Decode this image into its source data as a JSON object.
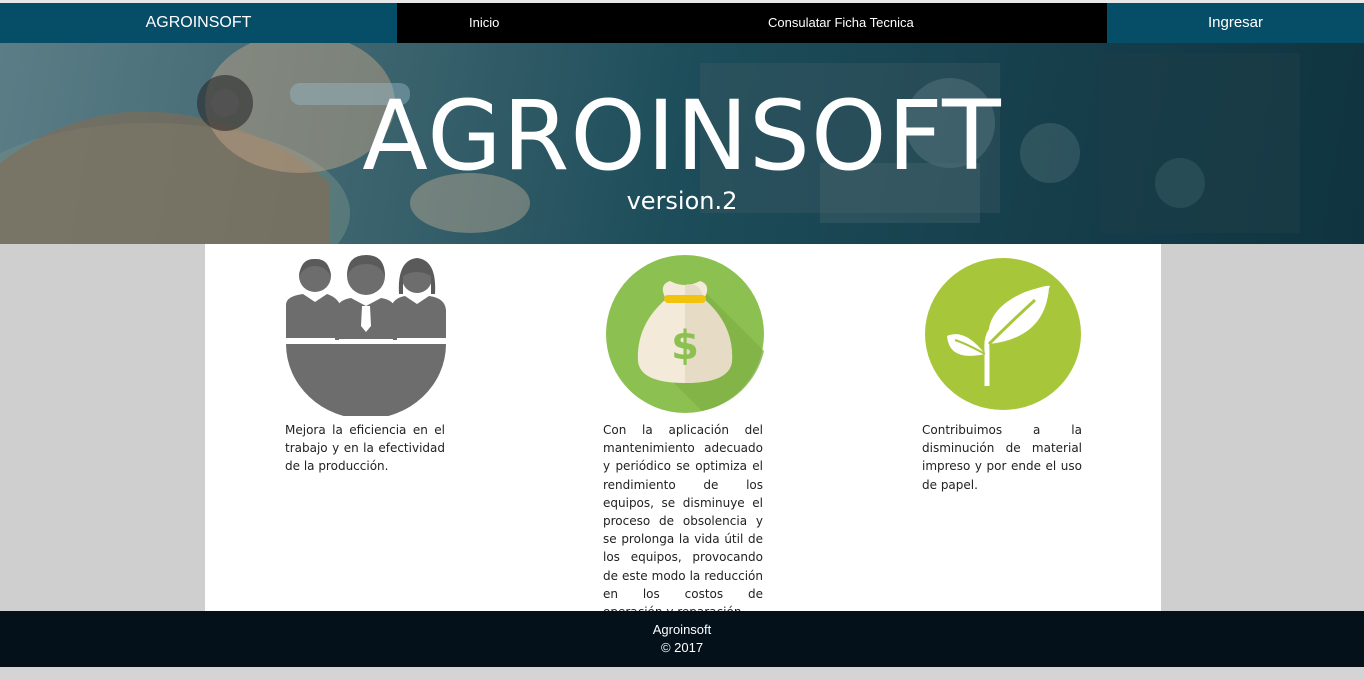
{
  "navbar": {
    "brand": "AGROINSOFT",
    "links": [
      "Inicio",
      "Consulatar Ficha Tecnica"
    ],
    "login_label": "Ingresar"
  },
  "hero": {
    "title": "AGROINSOFT",
    "subtitle": "version.2"
  },
  "features": [
    {
      "icon": "team-people-icon",
      "text": "Mejora la eficiencia en el trabajo y en la efectividad de la producción."
    },
    {
      "icon": "money-bag-icon",
      "text": "Con la aplicación del mantenimiento adecuado y periódico se optimiza el rendimiento de los equipos, se disminuye el proceso de obsolencia y se prolonga la vida útil de los equipos, provocando de este modo la reducción en los costos de operación y reparación."
    },
    {
      "icon": "leaf-icon",
      "text": "Contribuimos a la disminución de material impreso y por ende el uso de papel."
    }
  ],
  "footer": {
    "name": "Agroinsoft",
    "copyright": "© 2017"
  },
  "colors": {
    "nav_accent": "#064d68",
    "money_green": "#8cc152",
    "leaf_green": "#a8c63a",
    "footer_bg": "#04101a"
  }
}
